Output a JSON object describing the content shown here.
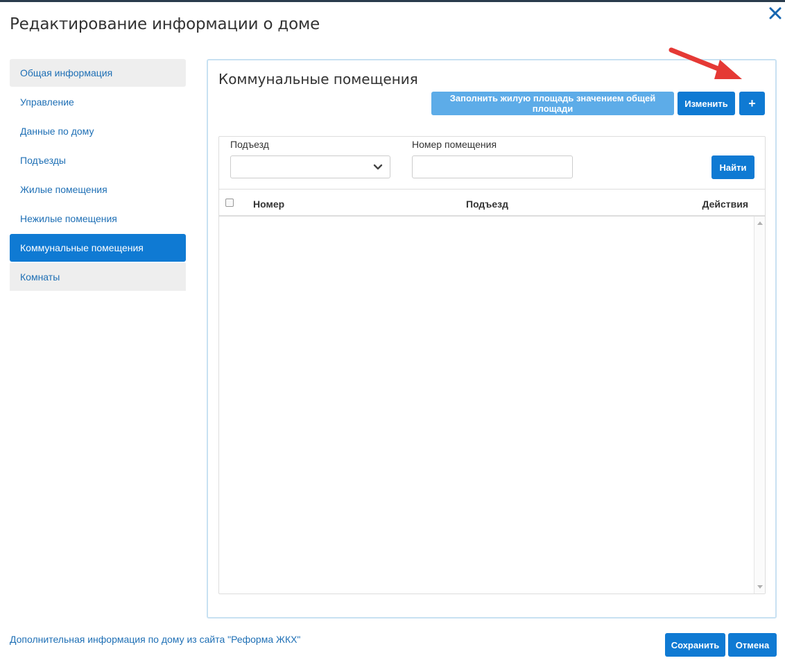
{
  "modal": {
    "title": "Редактирование информации о доме",
    "close_icon": "close-x-icon"
  },
  "sidebar": {
    "items": [
      {
        "label": "Общая информация",
        "state": "inactive-gray"
      },
      {
        "label": "Управление",
        "state": "inactive"
      },
      {
        "label": "Данные по дому",
        "state": "inactive"
      },
      {
        "label": "Подъезды",
        "state": "inactive"
      },
      {
        "label": "Жилые помещения",
        "state": "inactive"
      },
      {
        "label": "Нежилые помещения",
        "state": "inactive"
      },
      {
        "label": "Коммунальные помещения",
        "state": "active"
      },
      {
        "label": "Комнаты",
        "state": "inactive-gray"
      }
    ]
  },
  "panel": {
    "title": "Коммунальные помещения",
    "buttons": {
      "fill_area": "Заполнить жилую площадь значением общей площади",
      "edit": "Изменить",
      "add": "+"
    }
  },
  "filters": {
    "entrance_label": "Подъезд",
    "entrance_value": "",
    "number_label": "Номер помещения",
    "number_value": "",
    "find_button": "Найти"
  },
  "table": {
    "columns": [
      "Номер",
      "Подъезд",
      "Действия"
    ],
    "rows": []
  },
  "footer": {
    "link": "Дополнительная информация по дому из сайта \"Реформа ЖКХ\"",
    "save": "Сохранить",
    "cancel": "Отмена"
  },
  "colors": {
    "primary": "#0f7ad3",
    "primary_light": "#5dace8",
    "link": "#1e6fb5",
    "panel_border": "#c8e1f2",
    "annotation_arrow": "#e53935"
  }
}
